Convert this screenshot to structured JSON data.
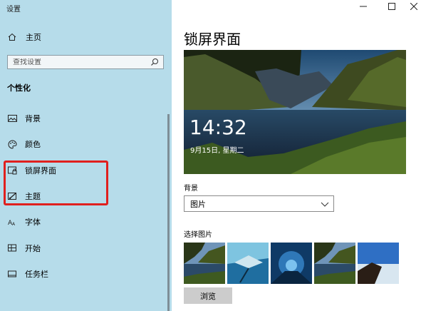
{
  "app": {
    "title": "设置"
  },
  "window": {
    "minimize_icon": "minimize-icon",
    "maximize_icon": "maximize-icon",
    "close_icon": "close-icon"
  },
  "sidebar": {
    "home_label": "主页",
    "home_icon": "home-icon",
    "search_placeholder": "查找设置",
    "search_icon": "search-icon",
    "section_title": "个性化",
    "items": [
      {
        "label": "背景",
        "icon": "background-picture-icon"
      },
      {
        "label": "颜色",
        "icon": "palette-icon"
      },
      {
        "label": "锁屏界面",
        "icon": "lock-screen-icon"
      },
      {
        "label": "主题",
        "icon": "themes-brush-icon"
      },
      {
        "label": "字体",
        "icon": "font-icon"
      },
      {
        "label": "开始",
        "icon": "start-menu-icon"
      },
      {
        "label": "任务栏",
        "icon": "taskbar-icon"
      }
    ],
    "highlight_color": "#e0201e",
    "background_color": "#b6dcea"
  },
  "main": {
    "title": "锁屏界面",
    "preview": {
      "time": "14:32",
      "date": "9月15日, 星期二"
    },
    "background_label": "背景",
    "background_select": {
      "value": "图片"
    },
    "choose_picture_label": "选择图片",
    "thumbnails": [
      {
        "name": "lake-mountains"
      },
      {
        "name": "underwater-ray"
      },
      {
        "name": "ice-cave"
      },
      {
        "name": "lake-mountains-2"
      },
      {
        "name": "coast-sky"
      }
    ],
    "browse_button": "浏览"
  }
}
